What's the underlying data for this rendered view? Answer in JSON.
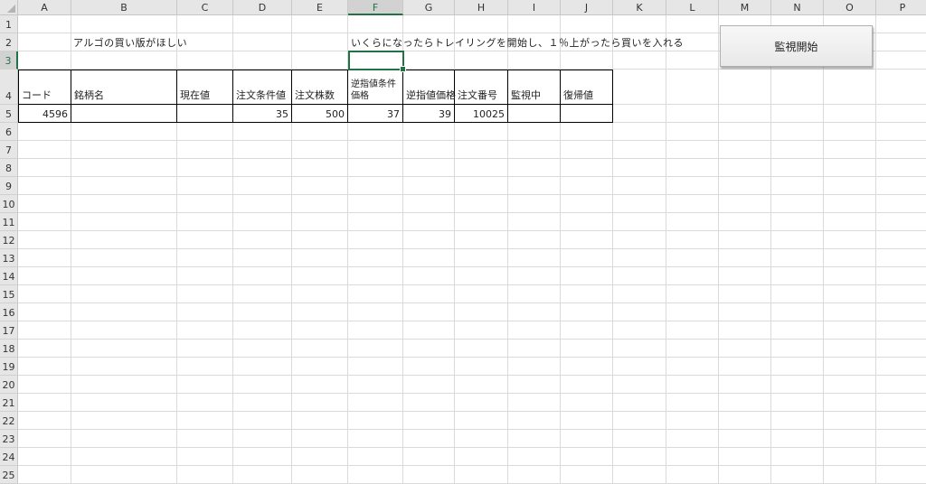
{
  "columns": [
    "A",
    "B",
    "C",
    "D",
    "E",
    "F",
    "G",
    "H",
    "I",
    "J",
    "K",
    "L",
    "M",
    "N",
    "O",
    "P"
  ],
  "rows": [
    "1",
    "2",
    "3",
    "4",
    "5",
    "6",
    "7",
    "8",
    "9",
    "10",
    "11",
    "12",
    "13",
    "14",
    "15",
    "16",
    "17",
    "18",
    "19",
    "20",
    "21",
    "22",
    "23",
    "24",
    "25"
  ],
  "selected": {
    "column": "F",
    "row": "3"
  },
  "notes": {
    "b2": "アルゴの買い版がほしい",
    "f2": "いくらになったらトレイリングを開始し、１％上がったら買いを入れる"
  },
  "table": {
    "headers": [
      "コード",
      "銘柄名",
      "現在値",
      "注文条件値",
      "注文株数",
      "逆指値条件価格",
      "逆指値価格",
      "注文番号",
      "監視中",
      "復帰値"
    ],
    "row5": [
      "4596",
      "",
      "",
      "35",
      "500",
      "37",
      "39",
      "10025",
      "",
      ""
    ]
  },
  "button": {
    "label": "監視開始"
  }
}
